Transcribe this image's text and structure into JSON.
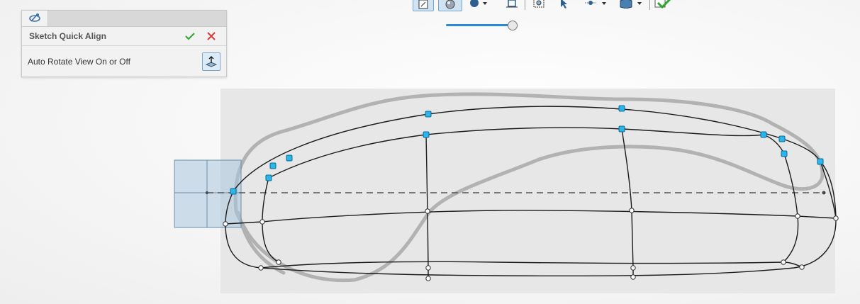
{
  "panel": {
    "title": "Sketch Quick Align",
    "option_label": "Auto Rotate View On or Off",
    "tab_icon": "sketch-align-icon",
    "ok_icon": "checkmark-icon",
    "cancel_icon": "close-icon",
    "rotate_icon": "rotate-view-icon"
  },
  "toolbar": {
    "icons": [
      "view-orientation-icon",
      "display-style-icon",
      "hide-show-icon",
      "edit-appearance-icon",
      "zoom-to-fit-icon",
      "select-icon",
      "view-settings-icon",
      "section-view-icon",
      "confirm-corner-icon"
    ],
    "slider_value": 0.95
  },
  "colors": {
    "accent": "#2a8ad6",
    "ok": "#3aa63a",
    "cancel": "#d63a3a",
    "handle": "#2bb5e8",
    "selection_box": "#a9c7dc"
  }
}
